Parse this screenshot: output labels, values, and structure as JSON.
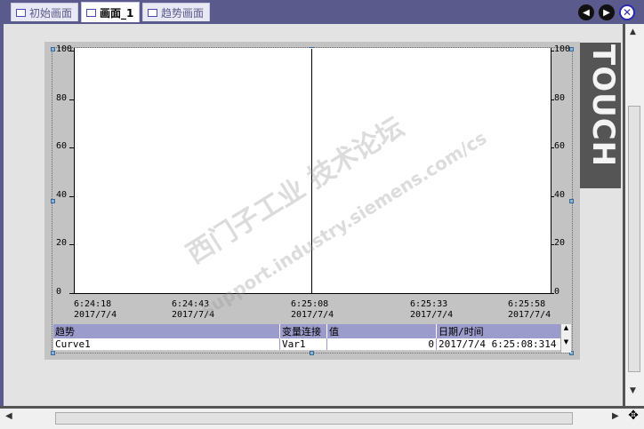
{
  "tabs": [
    {
      "label": "初始画面",
      "active": false
    },
    {
      "label": "画面_1",
      "active": true
    },
    {
      "label": "趋势画面",
      "active": false
    }
  ],
  "nav": {
    "prev_icon": "◀",
    "next_icon": "▶",
    "close_icon": "✕"
  },
  "touch_banner": "TOUCH",
  "chart_data": {
    "type": "line",
    "title": "",
    "y_left_ticks": [
      "100",
      "80",
      "60",
      "40",
      "20",
      "0"
    ],
    "y_right_ticks": [
      "100",
      "80",
      "60",
      "40",
      "20",
      "0"
    ],
    "ylim": [
      0,
      100
    ],
    "x_ticks": [
      {
        "time": "6:24:18",
        "date": "2017/7/4"
      },
      {
        "time": "6:24:43",
        "date": "2017/7/4"
      },
      {
        "time": "6:25:08",
        "date": "2017/7/4"
      },
      {
        "time": "6:25:33",
        "date": "2017/7/4"
      },
      {
        "time": "6:25:58",
        "date": "2017/7/4"
      }
    ],
    "series": []
  },
  "trend_table": {
    "headers": [
      "趋势",
      "变量连接",
      "值",
      "日期/时间"
    ],
    "rows": [
      [
        "Curve1",
        "Var1",
        "0",
        "2017/7/4 6:25:08:314"
      ]
    ]
  },
  "watermark": {
    "line1": "西门子工业 技术论坛",
    "line2": "support.industry.siemens.com/cs"
  },
  "colors": {
    "titlebar": "#5a5a8c",
    "table_header": "#9b9bcc"
  }
}
